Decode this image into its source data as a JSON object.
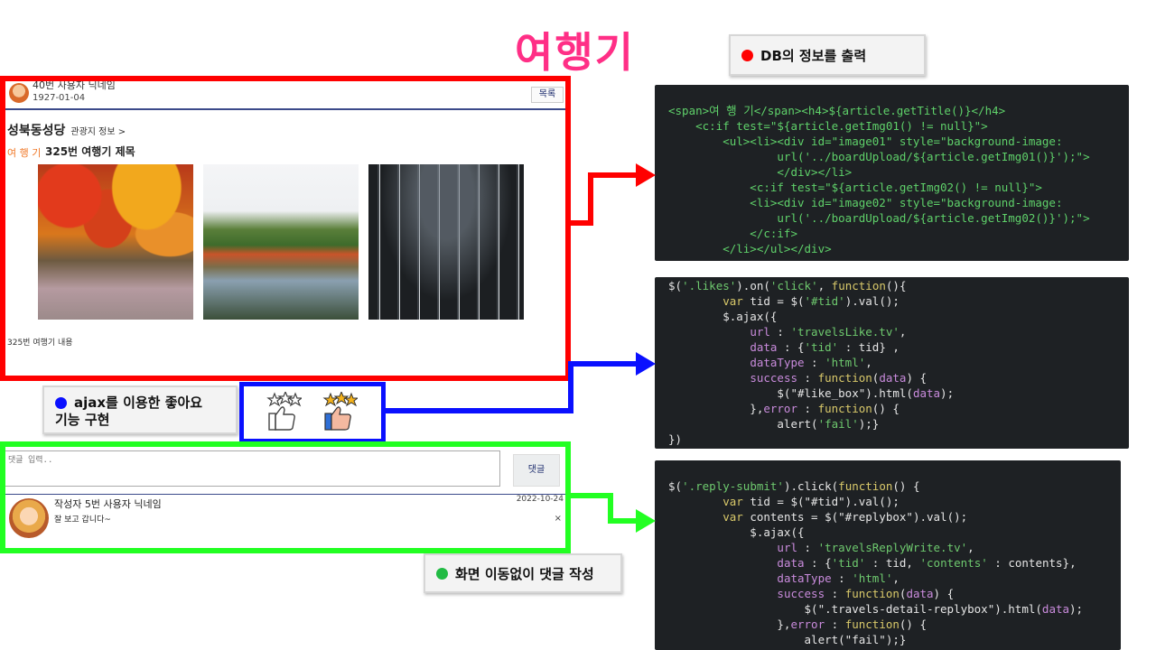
{
  "slide": {
    "title": "여행기"
  },
  "callouts": {
    "db": {
      "text": "DB의 정보를 출력",
      "color": "#ff0000"
    },
    "ajax": {
      "line1": "ajax를 이용한 좋아요",
      "line2": "기능 구현",
      "color": "#0000ff"
    },
    "reply": {
      "text": "화면 이동없이 댓글 작성",
      "color": "#22bb44"
    }
  },
  "article": {
    "author": "40번 사용자 닉네임",
    "date": "1927-01-04",
    "list_button": "목록",
    "place": "성북동성당",
    "place_link": "관광지 정보 >",
    "tag": "여 행 기",
    "title": "325번 여행기 제목",
    "content": "325번 여행기 내용"
  },
  "likes": {
    "empty_icon": "thumbs-up-outline-icon",
    "filled_icon": "thumbs-up-filled-icon"
  },
  "reply": {
    "placeholder": "댓글 입력..",
    "submit_label": "댓글",
    "author": "작성자 5번 사용자 닉네임",
    "date": "2022-10-24",
    "text": "잘 보고 갑니다~",
    "delete": "×"
  },
  "code": {
    "db_code": [
      "<span>여 행 기</span><h4>${article.getTitle()}</h4>",
      "    <c:if test=\"${article.getImg01() != null}\">",
      "        <ul><li><div id=\"image01\" style=\"background-image:",
      "                url('../boardUpload/${article.getImg01()}');\">",
      "                </div></li>",
      "            <c:if test=\"${article.getImg02() != null}\">",
      "            <li><div id=\"image02\" style=\"background-image:",
      "                url('../boardUpload/${article.getImg02()}');\">",
      "            </c:if>",
      "        </li></ul></div>"
    ],
    "like_code": [
      "$('.likes').on('click', function(){",
      "        var tid = $('#tid').val();",
      "        $.ajax({",
      "            url : 'travelsLike.tv',",
      "            data : {'tid' : tid} ,",
      "            dataType : 'html',",
      "            success : function(data) {",
      "                $(\"#like_box\").html(data);",
      "            },error : function() {",
      "                alert('fail');}",
      "})"
    ],
    "reply_code": [
      "$('.reply-submit').click(function() {",
      "        var tid = $(\"#tid\").val();",
      "        var contents = $(\"#replybox\").val();",
      "            $.ajax({",
      "                url : 'travelsReplyWrite.tv',",
      "                data : {'tid' : tid, 'contents' : contents},",
      "                dataType : 'html',",
      "                success : function(data) {",
      "                    $(\".travels-detail-replybox\").html(data);",
      "                },error : function() {",
      "                    alert(\"fail\");}"
    ]
  }
}
